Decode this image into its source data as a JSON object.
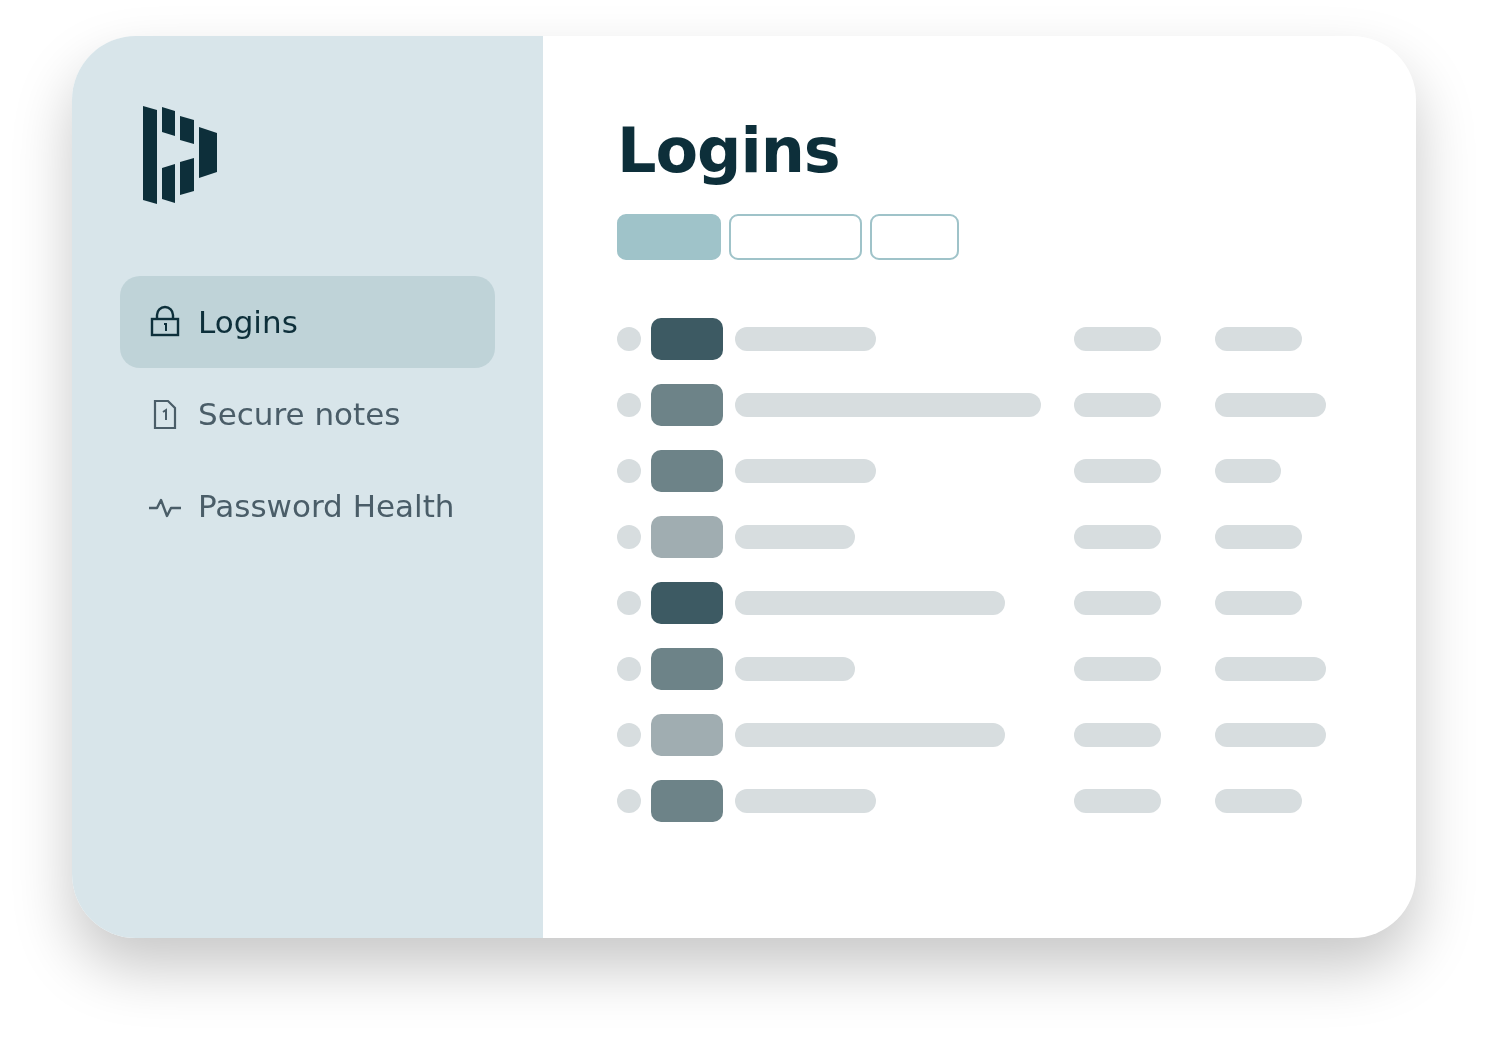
{
  "sidebar": {
    "items": [
      {
        "label": "Logins",
        "selected": true
      },
      {
        "label": "Secure notes",
        "selected": false
      },
      {
        "label": "Password Health",
        "selected": false
      }
    ]
  },
  "title": "Logins",
  "filters": [
    {
      "selected": true
    },
    {
      "selected": false
    },
    {
      "selected": false
    }
  ],
  "rows": [
    {
      "color": "#3d5a63"
    },
    {
      "color": "#6d8388"
    },
    {
      "color": "#6d8388"
    },
    {
      "color": "#a0adb1"
    },
    {
      "color": "#3d5a63"
    },
    {
      "color": "#6d8388"
    },
    {
      "color": "#a0adb1"
    },
    {
      "color": "#6d8388"
    }
  ]
}
